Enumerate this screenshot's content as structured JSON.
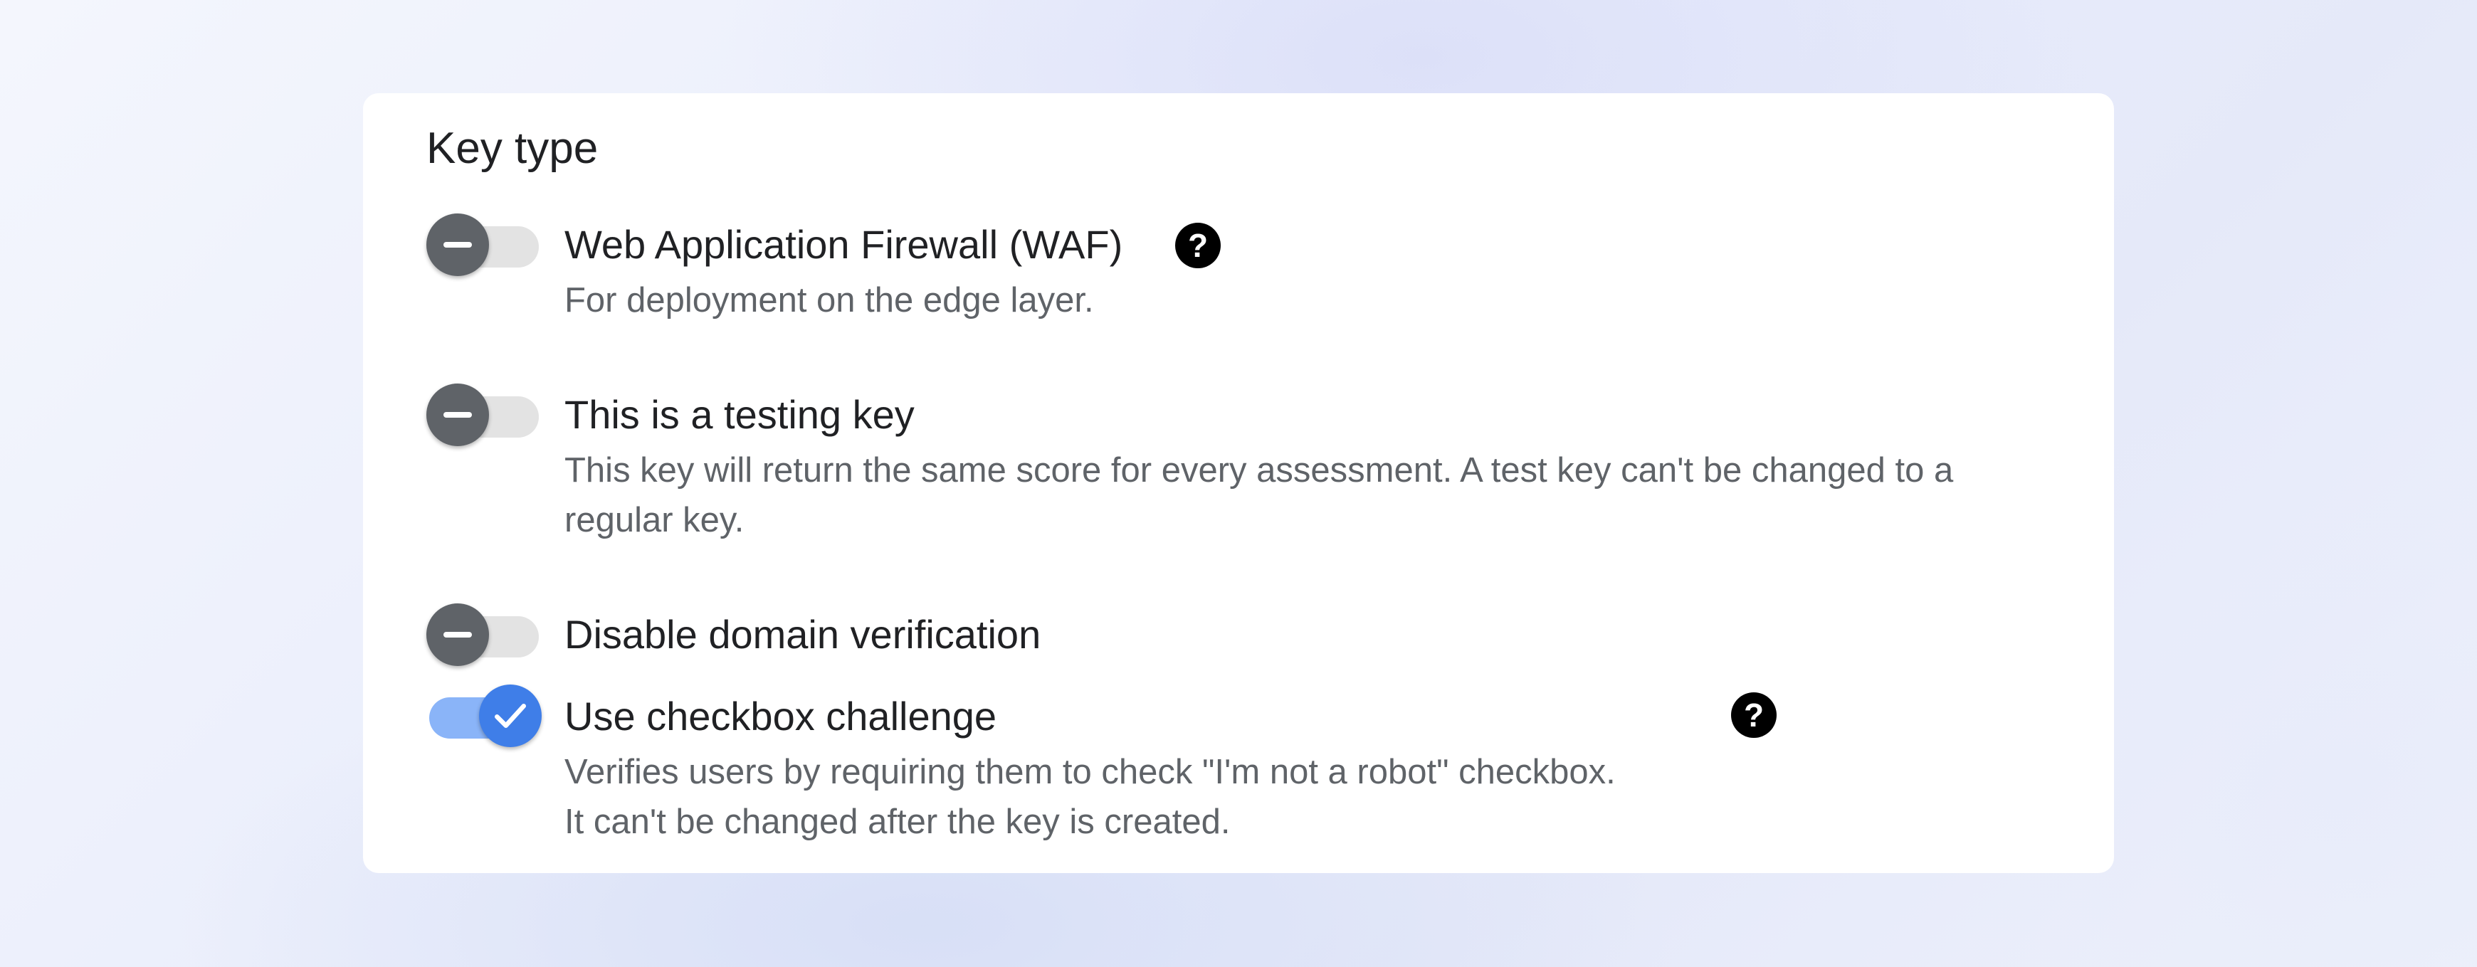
{
  "card": {
    "title": "Key type"
  },
  "options": [
    {
      "label": "Web Application Firewall (WAF)",
      "description": "For deployment on the edge layer.",
      "enabled": false,
      "help_icon": "help-circle-icon"
    },
    {
      "label": "This is a testing key",
      "description": "This key will return the same score for every assessment. A test key can't be changed to a regular key.",
      "enabled": false
    },
    {
      "label": "Disable domain verification",
      "enabled": false
    },
    {
      "label": "Use checkbox challenge",
      "description_line1": "Verifies users by requiring them to check \"I'm not a robot\" checkbox.",
      "description_line2": "It can't be changed after the key is created.",
      "enabled": true,
      "help_icon": "help-circle-icon"
    }
  ],
  "icons": {
    "help_glyph": "?",
    "off_thumb": "minus-icon",
    "on_thumb": "check-icon"
  },
  "colors": {
    "toggle_on_track": "#8ab4f8",
    "toggle_on_thumb": "#3f7ee8",
    "toggle_off_track": "#e3e3e3",
    "toggle_off_thumb": "#5f6368",
    "label_text": "#202124",
    "description_text": "#5f6368"
  }
}
